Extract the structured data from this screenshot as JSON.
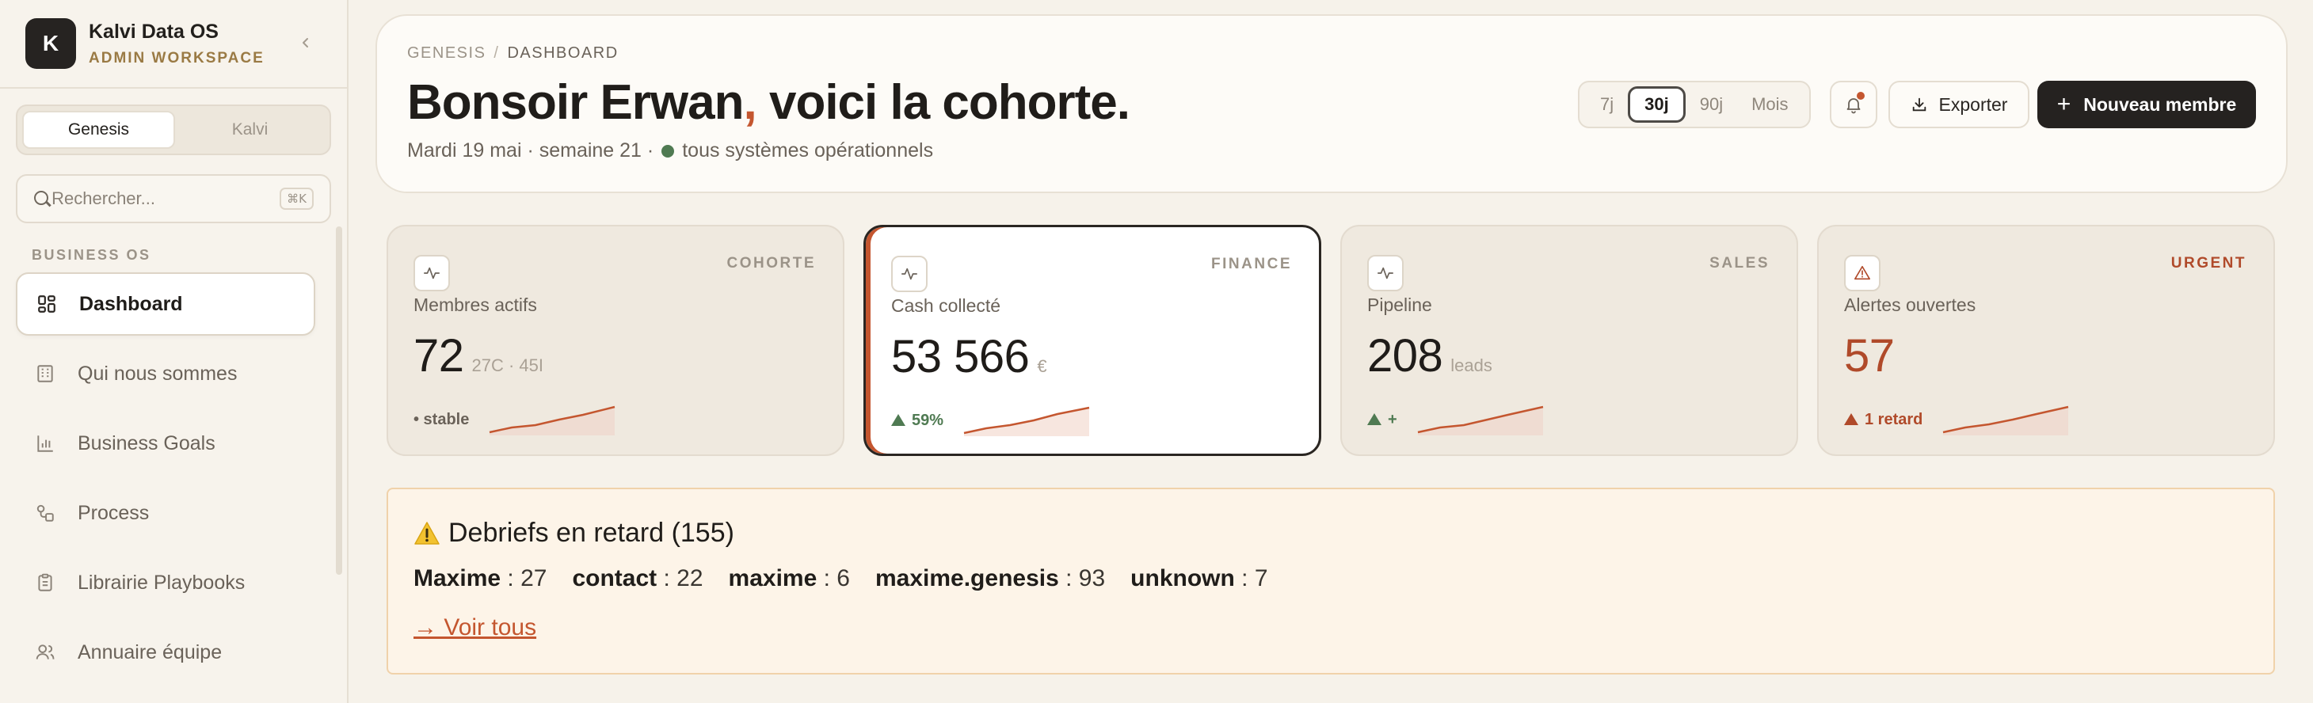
{
  "brand": {
    "logo_letter": "K",
    "name": "Kalvi Data OS",
    "workspace": "ADMIN WORKSPACE"
  },
  "workspace_switch": {
    "options": [
      "Genesis",
      "Kalvi"
    ],
    "selected": "Genesis"
  },
  "search": {
    "placeholder": "Rechercher...",
    "shortcut": "⌘K"
  },
  "sidebar": {
    "section": "BUSINESS OS",
    "items": [
      {
        "label": "Dashboard",
        "icon": "grid-icon",
        "active": true
      },
      {
        "label": "Qui nous sommes",
        "icon": "building-icon"
      },
      {
        "label": "Business Goals",
        "icon": "bar-chart-icon"
      },
      {
        "label": "Process",
        "icon": "workflow-icon"
      },
      {
        "label": "Librairie Playbooks",
        "icon": "clipboard-icon"
      },
      {
        "label": "Annuaire équipe",
        "icon": "users-icon"
      }
    ]
  },
  "header": {
    "breadcrumb": [
      "GENESIS",
      "DASHBOARD"
    ],
    "greeting_name": "Bonsoir Erwan",
    "greeting_comma": ",",
    "greeting_rest": " voici la cohorte.",
    "subline": "Mardi 19 mai · semaine 21 ·",
    "status": "tous systèmes opérationnels",
    "ranges": [
      "7j",
      "30j",
      "90j",
      "Mois"
    ],
    "selected_range": "30j",
    "export_label": "Exporter",
    "new_member_label": "Nouveau membre"
  },
  "kpis": [
    {
      "tag": "COHORTE",
      "label": "Membres actifs",
      "value": "72",
      "unit": "27C · 45I",
      "trend": "• stable",
      "trend_kind": "neutral",
      "icon": "activity-icon"
    },
    {
      "tag": "FINANCE",
      "label": "Cash collecté",
      "value": "53 566",
      "unit": "€",
      "trend": "59%",
      "trend_kind": "up",
      "icon": "activity-icon"
    },
    {
      "tag": "SALES",
      "label": "Pipeline",
      "value": "208",
      "unit": "leads",
      "trend": "+",
      "trend_kind": "up",
      "icon": "activity-icon"
    },
    {
      "tag": "URGENT",
      "label": "Alertes ouvertes",
      "value": "57",
      "unit": "",
      "trend": "1 retard",
      "trend_kind": "alert",
      "icon": "alert-triangle-icon"
    }
  ],
  "debriefs": {
    "icon": "⚠️",
    "title": "Debriefs en retard (155)",
    "stats": [
      {
        "name": "Maxime",
        "count": "27"
      },
      {
        "name": "contact",
        "count": "22"
      },
      {
        "name": "maxime",
        "count": "6"
      },
      {
        "name": "maxime.genesis",
        "count": "93"
      },
      {
        "name": "unknown",
        "count": "7"
      }
    ],
    "see_all": "→ Voir tous"
  },
  "colors": {
    "accent": "#c4562f",
    "success": "#4f7a52",
    "danger": "#b04a2a",
    "dark": "#252220"
  }
}
